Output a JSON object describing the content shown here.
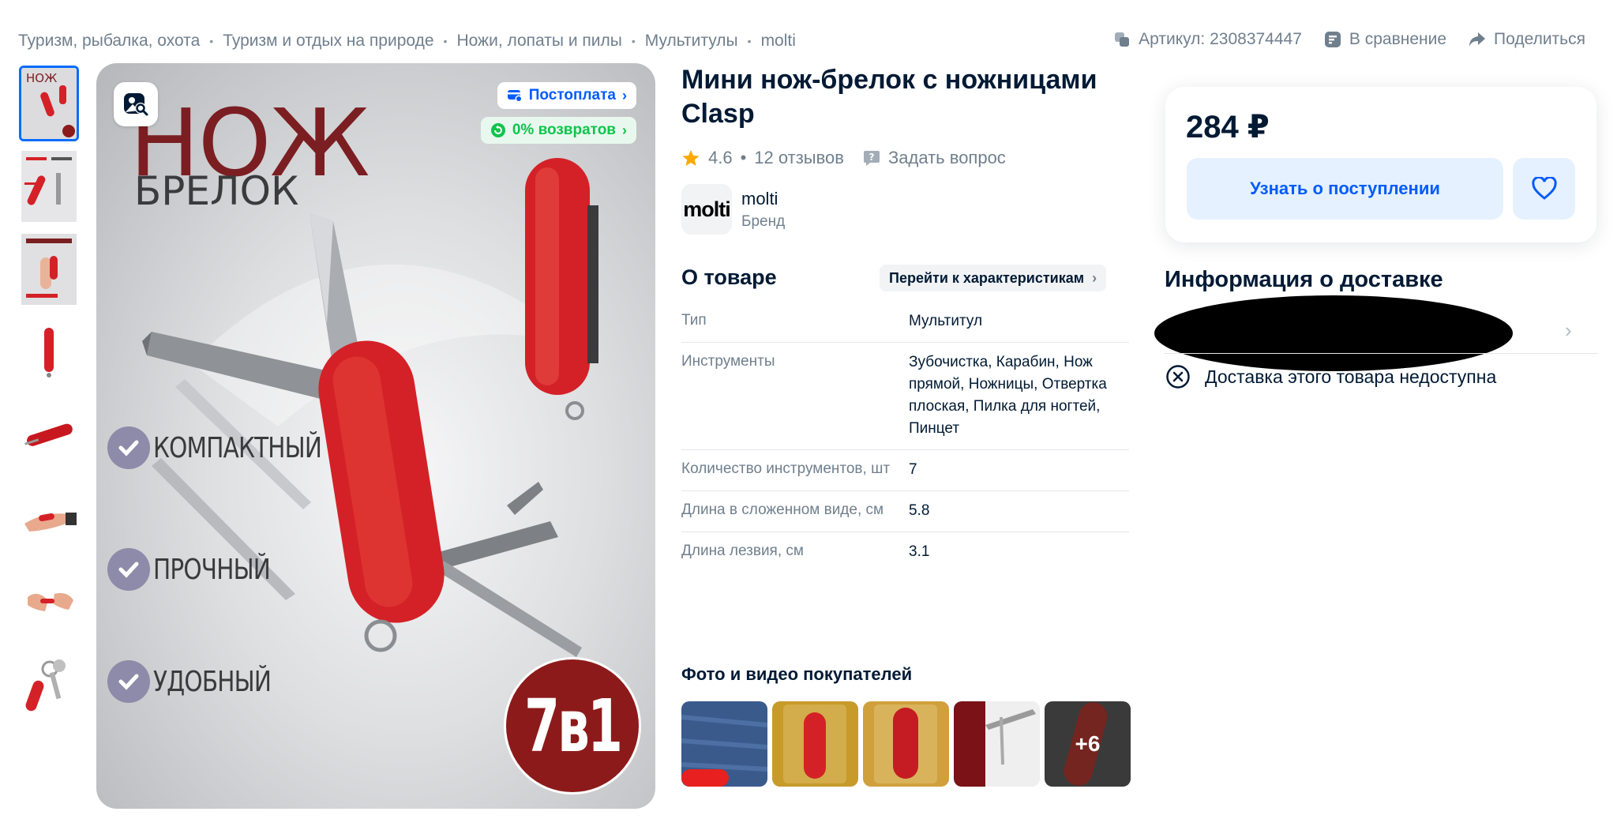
{
  "breadcrumbs": [
    "Туризм, рыбалка, охота",
    "Туризм и отдых на природе",
    "Ножи, лопаты и пилы",
    "Мультитулы",
    "molti"
  ],
  "breadcrumb_sep": "•",
  "top_actions": {
    "article": "Артикул: 2308374447",
    "compare": "В сравнение",
    "share": "Поделиться"
  },
  "image": {
    "badge_postpay": "Постоплата",
    "badge_returns": "0% возвратов",
    "headline_1": "НОЖ",
    "headline_2": "БРЕЛОК",
    "features": [
      "КОМПАКТНЫЙ",
      "ПРОЧНЫЙ",
      "УДОБНЫЙ"
    ],
    "badge_count": "7в1"
  },
  "product": {
    "title": "Мини нож-брелок с ножницами Clasp",
    "rating": "4.6",
    "rating_sep": "•",
    "reviews": "12 отзывов",
    "ask_question": "Задать вопрос",
    "brand_name": "molti",
    "brand_logo_text": "molti",
    "brand_type": "Бренд"
  },
  "about": {
    "heading": "О товаре",
    "to_characteristics": "Перейти к характеристикам",
    "specs": [
      {
        "key": "Тип",
        "value": "Мультитул"
      },
      {
        "key": "Инструменты",
        "value": "Зубочистка, Карабин, Нож прямой, Ножницы, Отвертка плоская, Пилка для ногтей, Пинцет"
      },
      {
        "key": "Количество инструментов, шт",
        "value": "7"
      },
      {
        "key": "Длина в сложенном виде, см",
        "value": "5.8"
      },
      {
        "key": "Длина лезвия, см",
        "value": "3.1"
      }
    ]
  },
  "customer_photos": {
    "heading": "Фото и видео покупателей",
    "more": "+6"
  },
  "buy": {
    "price": "284 ₽",
    "notify": "Узнать о поступлении"
  },
  "delivery": {
    "heading": "Информация о доставке",
    "unavailable": "Доставка этого товара недоступна"
  },
  "colors": {
    "accent": "#005bff",
    "text": "#001a34",
    "muted": "#707f8d",
    "product_red": "#d42127"
  }
}
